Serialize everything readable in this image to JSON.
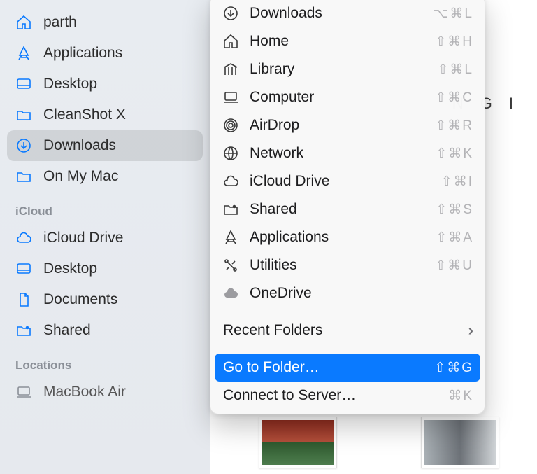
{
  "sidebar": {
    "favorites": [
      {
        "label": "parth",
        "icon": "home-icon"
      },
      {
        "label": "Applications",
        "icon": "applications-icon"
      },
      {
        "label": "Desktop",
        "icon": "desktop-icon"
      },
      {
        "label": "CleanShot X",
        "icon": "folder-icon"
      },
      {
        "label": "Downloads",
        "icon": "downloads-icon",
        "selected": true
      },
      {
        "label": "On My Mac",
        "icon": "folder-icon"
      }
    ],
    "sections": [
      {
        "heading": "iCloud",
        "items": [
          {
            "label": "iCloud Drive",
            "icon": "cloud-icon"
          },
          {
            "label": "Desktop",
            "icon": "desktop-icon"
          },
          {
            "label": "Documents",
            "icon": "document-icon"
          },
          {
            "label": "Shared",
            "icon": "shared-folder-icon"
          }
        ]
      },
      {
        "heading": "Locations",
        "items": [
          {
            "label": "MacBook Air",
            "icon": "laptop-icon"
          }
        ]
      }
    ]
  },
  "menu": {
    "items": [
      {
        "label": "Downloads",
        "icon": "downloads-icon",
        "shortcut": "⌥⌘L"
      },
      {
        "label": "Home",
        "icon": "home-icon",
        "shortcut": "⇧⌘H"
      },
      {
        "label": "Library",
        "icon": "library-icon",
        "shortcut": "⇧⌘L"
      },
      {
        "label": "Computer",
        "icon": "computer-icon",
        "shortcut": "⇧⌘C"
      },
      {
        "label": "AirDrop",
        "icon": "airdrop-icon",
        "shortcut": "⇧⌘R"
      },
      {
        "label": "Network",
        "icon": "network-icon",
        "shortcut": "⇧⌘K"
      },
      {
        "label": "iCloud Drive",
        "icon": "cloud-icon",
        "shortcut": "⇧⌘I"
      },
      {
        "label": "Shared",
        "icon": "shared-folder-icon",
        "shortcut": "⇧⌘S"
      },
      {
        "label": "Applications",
        "icon": "applications-icon",
        "shortcut": "⇧⌘A"
      },
      {
        "label": "Utilities",
        "icon": "utilities-icon",
        "shortcut": "⇧⌘U"
      },
      {
        "label": "OneDrive",
        "icon": "cloud-solid-icon",
        "shortcut": ""
      }
    ],
    "recent": {
      "label": "Recent Folders",
      "chevron": "›"
    },
    "goto": {
      "label": "Go to Folder…",
      "shortcut": "⇧⌘G"
    },
    "connect": {
      "label": "Connect to Server…",
      "shortcut": "⌘K"
    }
  },
  "content": {
    "right_text": "NGI"
  }
}
